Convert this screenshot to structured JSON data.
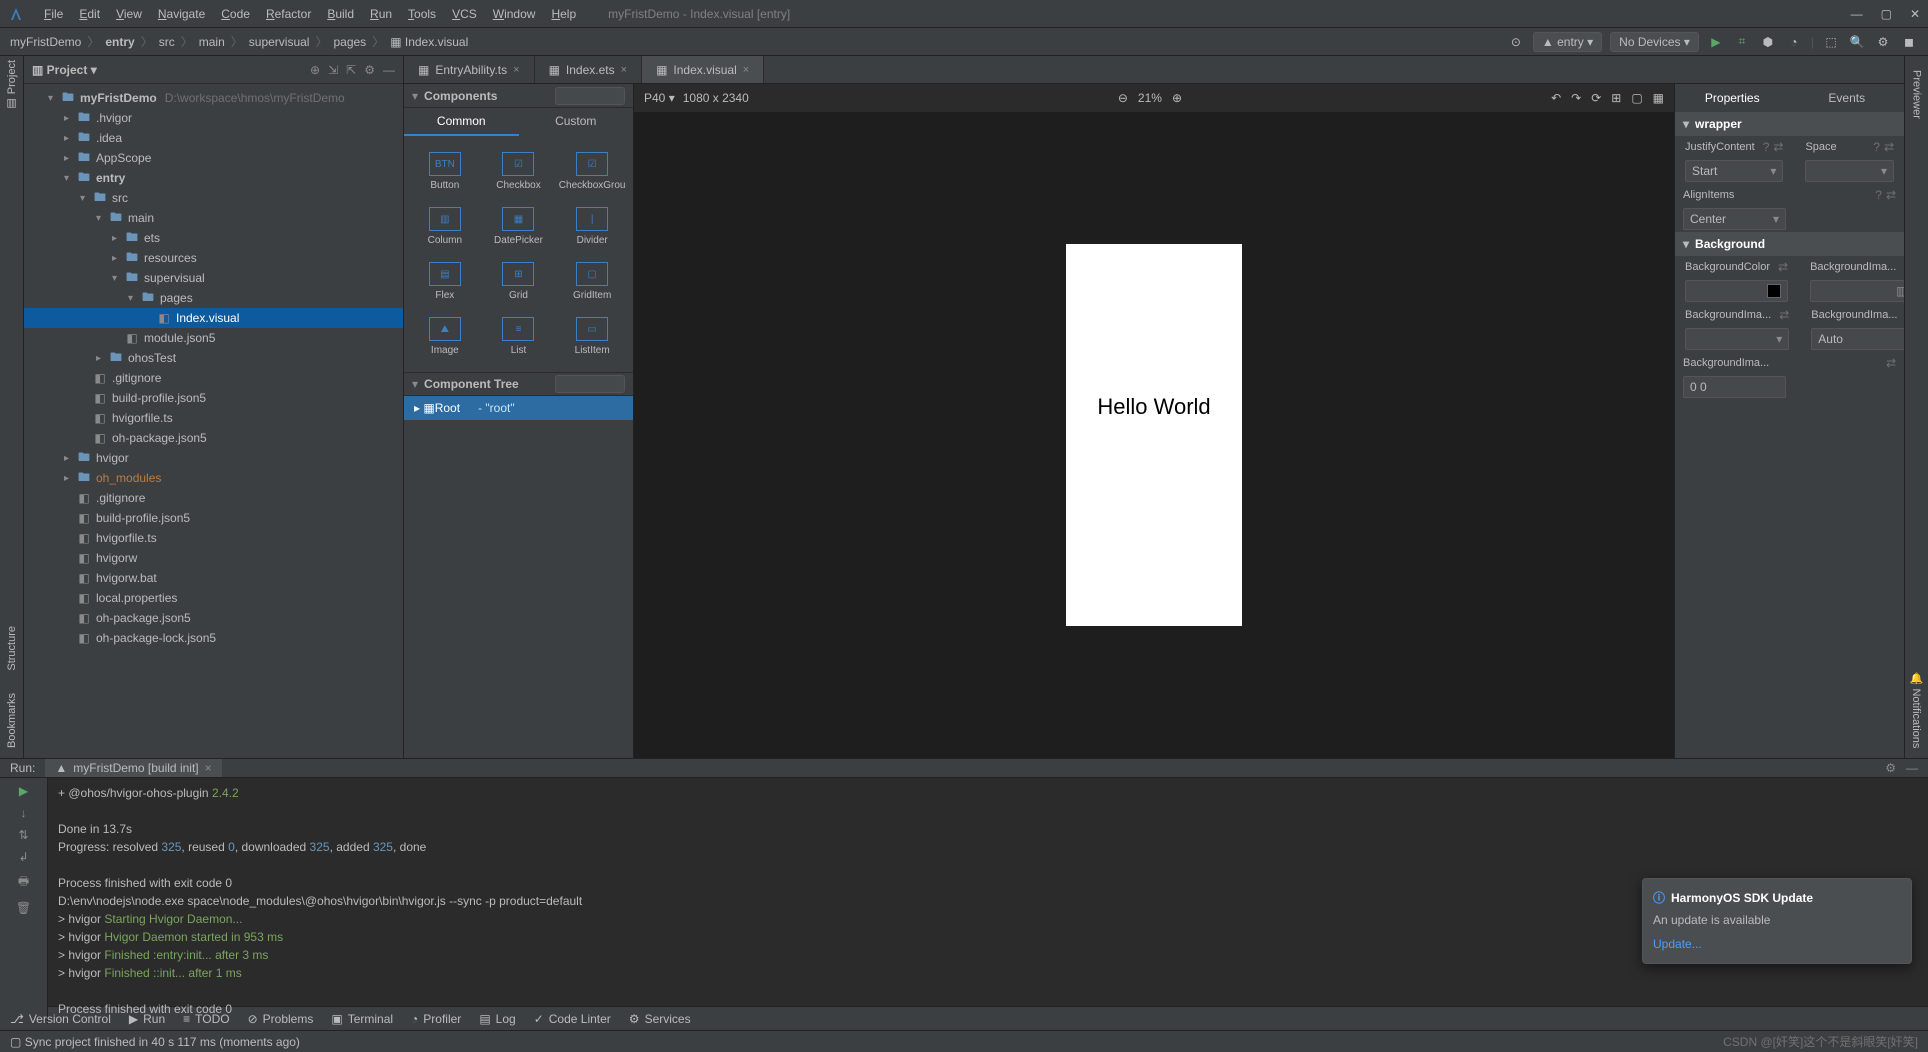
{
  "window": {
    "title": "myFristDemo - Index.visual [entry]",
    "menus": [
      "File",
      "Edit",
      "View",
      "Navigate",
      "Code",
      "Refactor",
      "Build",
      "Run",
      "Tools",
      "VCS",
      "Window",
      "Help"
    ]
  },
  "breadcrumbs": {
    "items": [
      "myFristDemo",
      "entry",
      "src",
      "main",
      "supervisual",
      "pages",
      "Index.visual"
    ],
    "right": {
      "config": "entry",
      "devices": "No Devices"
    }
  },
  "project": {
    "title": "Project",
    "root": "myFristDemo",
    "root_path": "D:\\workspace\\hmos\\myFristDemo",
    "tree": [
      {
        "l": 1,
        "t": "folder",
        "a": "▾",
        "n": "myFristDemo",
        "path": "D:\\workspace\\hmos\\myFristDemo",
        "bold": true
      },
      {
        "l": 2,
        "t": "folder",
        "a": "▸",
        "n": ".hvigor"
      },
      {
        "l": 2,
        "t": "folder",
        "a": "▸",
        "n": ".idea"
      },
      {
        "l": 2,
        "t": "folder",
        "a": "▸",
        "n": "AppScope"
      },
      {
        "l": 2,
        "t": "folder",
        "a": "▾",
        "n": "entry",
        "bold": true
      },
      {
        "l": 3,
        "t": "folder",
        "a": "▾",
        "n": "src"
      },
      {
        "l": 4,
        "t": "folder",
        "a": "▾",
        "n": "main"
      },
      {
        "l": 5,
        "t": "folder",
        "a": "▸",
        "n": "ets"
      },
      {
        "l": 5,
        "t": "folder",
        "a": "▸",
        "n": "resources"
      },
      {
        "l": 5,
        "t": "folder",
        "a": "▾",
        "n": "supervisual"
      },
      {
        "l": 6,
        "t": "folder",
        "a": "▾",
        "n": "pages"
      },
      {
        "l": 7,
        "t": "file",
        "n": "Index.visual",
        "sel": true
      },
      {
        "l": 5,
        "t": "file",
        "n": "module.json5"
      },
      {
        "l": 4,
        "t": "folder",
        "a": "▸",
        "n": "ohosTest"
      },
      {
        "l": 3,
        "t": "file",
        "n": ".gitignore"
      },
      {
        "l": 3,
        "t": "file",
        "n": "build-profile.json5"
      },
      {
        "l": 3,
        "t": "file",
        "n": "hvigorfile.ts"
      },
      {
        "l": 3,
        "t": "file",
        "n": "oh-package.json5"
      },
      {
        "l": 2,
        "t": "folder",
        "a": "▸",
        "n": "hvigor"
      },
      {
        "l": 2,
        "t": "folder",
        "a": "▸",
        "n": "oh_modules",
        "dim": true
      },
      {
        "l": 2,
        "t": "file",
        "n": ".gitignore"
      },
      {
        "l": 2,
        "t": "file",
        "n": "build-profile.json5"
      },
      {
        "l": 2,
        "t": "file",
        "n": "hvigorfile.ts"
      },
      {
        "l": 2,
        "t": "file",
        "n": "hvigorw"
      },
      {
        "l": 2,
        "t": "file",
        "n": "hvigorw.bat"
      },
      {
        "l": 2,
        "t": "file",
        "n": "local.properties"
      },
      {
        "l": 2,
        "t": "file",
        "n": "oh-package.json5"
      },
      {
        "l": 2,
        "t": "file",
        "n": "oh-package-lock.json5"
      }
    ]
  },
  "editor_tabs": [
    {
      "label": "EntryAbility.ts",
      "active": false
    },
    {
      "label": "Index.ets",
      "active": false
    },
    {
      "label": "Index.visual",
      "active": true
    }
  ],
  "components": {
    "title": "Components",
    "tabs": [
      "Common",
      "Custom"
    ],
    "items": [
      "Button",
      "Checkbox",
      "CheckboxGrou",
      "Column",
      "DatePicker",
      "Divider",
      "Flex",
      "Grid",
      "GridItem",
      "Image",
      "List",
      "ListItem"
    ]
  },
  "component_tree": {
    "title": "Component Tree",
    "root_label": "Root",
    "root_note": "- \"root\""
  },
  "canvas": {
    "device": "P40",
    "resolution": "1080 x 2340",
    "zoom": "21%",
    "preview_text": "Hello World"
  },
  "properties": {
    "tabs": [
      "Properties",
      "Events"
    ],
    "wrapper_title": "wrapper",
    "background_title": "Background",
    "justifyContent_label": "JustifyContent",
    "justifyContent_value": "Start",
    "space_label": "Space",
    "alignItems_label": "AlignItems",
    "alignItems_value": "Center",
    "bgColor_label": "BackgroundColor",
    "bgImage_label": "BackgroundIma...",
    "bgImage_value": "Auto",
    "bgImage2_label": "BackgroundIma...",
    "bgImage3_label": "BackgroundIma...",
    "bgImage3_value": "0 0"
  },
  "run": {
    "label": "Run:",
    "tab": "myFristDemo [build init]",
    "lines": [
      {
        "pre": "+ @ohos/hvigor-ohos-plugin ",
        "cy": "2.4.2"
      },
      {
        "pre": ""
      },
      {
        "pre": "Done in 13.7s"
      },
      {
        "pre": "Progress: resolved ",
        "n1": "325",
        "s1": ", reused ",
        "n2": "0",
        "s2": ", downloaded ",
        "n3": "325",
        "s3": ", added ",
        "n4": "325",
        "s4": ", done"
      },
      {
        "pre": ""
      },
      {
        "pre": "Process finished with exit code 0"
      },
      {
        "pre": "D:\\env\\nodejs\\node.exe                                           space\\node_modules\\@ohos\\hvigor\\bin\\hvigor.js --sync -p product=default"
      },
      {
        "pre": "> hvigor ",
        "cy": "Starting Hvigor Daemon..."
      },
      {
        "pre": "> hvigor ",
        "cy": "Hvigor Daemon started in 953 ms"
      },
      {
        "pre": "> hvigor ",
        "cy": "Finished :entry:init... after 3 ms"
      },
      {
        "pre": "> hvigor ",
        "cy": "Finished ::init... after 1 ms"
      },
      {
        "pre": ""
      },
      {
        "pre": "Process finished with exit code 0"
      }
    ]
  },
  "notification": {
    "title": "HarmonyOS SDK Update",
    "body": "An update is available",
    "link": "Update..."
  },
  "status_tools": [
    {
      "icon": "⎇",
      "label": "Version Control"
    },
    {
      "icon": "▶",
      "label": "Run"
    },
    {
      "icon": "≡",
      "label": "TODO"
    },
    {
      "icon": "⊘",
      "label": "Problems"
    },
    {
      "icon": "▣",
      "label": "Terminal"
    },
    {
      "icon": "◔",
      "label": "Profiler"
    },
    {
      "icon": "▤",
      "label": "Log"
    },
    {
      "icon": "✓",
      "label": "Code Linter"
    },
    {
      "icon": "⚙",
      "label": "Services"
    }
  ],
  "statusbar": {
    "text": "Sync project finished in 40 s 117 ms (moments ago)",
    "watermark": "CSDN @[奸笑]这个不是斜眼笑[奸笑]"
  }
}
